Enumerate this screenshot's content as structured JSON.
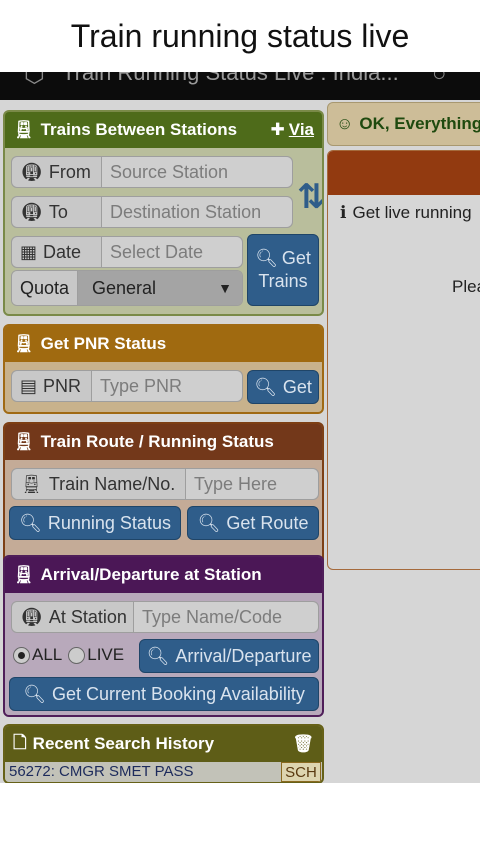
{
  "caption": "Train running status live",
  "browser": {
    "title": "Train Running Status Live : India...",
    "icon": "shield-icon",
    "menu_icon": "menu-icon"
  },
  "trains_between": {
    "title": "Trains Between Stations",
    "via_label": "Via",
    "from_label": "From",
    "from_placeholder": "Source Station",
    "to_label": "To",
    "to_placeholder": "Destination Station",
    "date_label": "Date",
    "date_placeholder": "Select Date",
    "get_trains_line1": "Get",
    "get_trains_line2": "Trains",
    "quota_label": "Quota",
    "quota_value": "General"
  },
  "pnr": {
    "title": "Get PNR Status",
    "label": "PNR",
    "placeholder": "Type PNR",
    "button": "Get"
  },
  "route": {
    "title": "Train Route / Running Status",
    "label": "Train Name/No.",
    "placeholder": "Type Here",
    "running_button": "Running Status",
    "route_button": "Get Route"
  },
  "arrival": {
    "title": "Arrival/Departure at Station",
    "label": "At Station",
    "placeholder": "Type Name/Code",
    "radio_all": "ALL",
    "radio_live": "LIVE",
    "arrdep_button": "Arrival/Departure",
    "booking_button": "Get Current Booking Availability"
  },
  "history": {
    "title": "Recent Search History",
    "item": "56272: CMGR SMET PASS",
    "tag": "SCH"
  },
  "right": {
    "banner": "OK, Everything",
    "info": "Get live running",
    "please": "Plea"
  },
  "colors": {
    "accent_blue": "#2f5d8a",
    "green_header": "#4e6b1a",
    "orange_header": "#a06a10",
    "brown_header": "#73381a",
    "purple_header": "#4b1756",
    "olive_header": "#5e5d17"
  }
}
